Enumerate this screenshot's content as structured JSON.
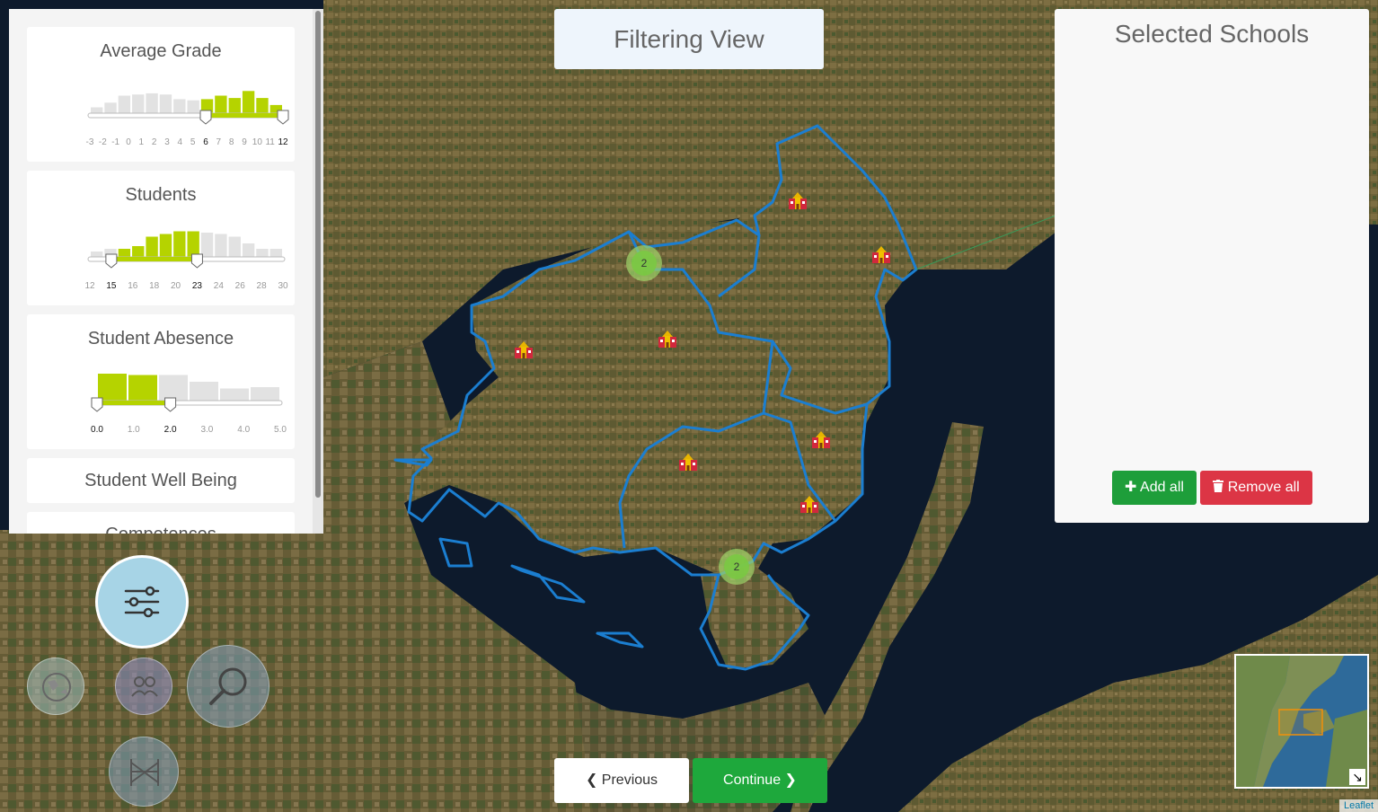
{
  "title": "Filtering View",
  "filters": {
    "average_grade": {
      "title": "Average Grade",
      "ticks": [
        "-3",
        "-2",
        "-1",
        "0",
        "1",
        "2",
        "3",
        "4",
        "5",
        "6",
        "7",
        "8",
        "9",
        "10",
        "11",
        "12"
      ],
      "selected_min": "6",
      "selected_max": "12",
      "histogram": [
        0.25,
        0.45,
        0.75,
        0.8,
        0.85,
        0.8,
        0.6,
        0.55,
        0.6,
        0.75,
        0.65,
        0.95,
        0.65,
        0.35
      ]
    },
    "students": {
      "title": "Students",
      "ticks": [
        "12",
        "15",
        "16",
        "18",
        "20",
        "23",
        "24",
        "26",
        "28",
        "30"
      ],
      "selected_min": "15",
      "selected_max": "23",
      "histogram": [
        0.2,
        0.3,
        0.3,
        0.4,
        0.75,
        0.85,
        0.95,
        0.95,
        0.9,
        0.85,
        0.75,
        0.5,
        0.3,
        0.3
      ]
    },
    "student_absence": {
      "title": "Student Abesence",
      "ticks": [
        "0.0",
        "1.0",
        "2.0",
        "3.0",
        "4.0",
        "5.0"
      ],
      "selected_min": "0.0",
      "selected_max": "2.0",
      "histogram": [
        1.0,
        0.95,
        0.95,
        0.7,
        0.45,
        0.5
      ]
    },
    "student_well_being": {
      "title": "Student Well Being"
    },
    "competences": {
      "title": "Competences"
    }
  },
  "selected_panel": {
    "title": "Selected Schools",
    "add_all_label": "Add all",
    "remove_all_label": "Remove all"
  },
  "nav": {
    "previous_label": "Previous",
    "continue_label": "Continue"
  },
  "map": {
    "clusters": [
      {
        "count": "2"
      },
      {
        "count": "2"
      }
    ],
    "school_marker_icon": "school-icon",
    "attribution": "Leaflet"
  },
  "tools": [
    "sliders-icon",
    "globe-icon",
    "people-icon",
    "search-icon",
    "parallel-coordinates-icon"
  ],
  "colors": {
    "histogram_selected": "#b5d300",
    "histogram_unselected": "#e2e2e2",
    "boundary": "#1b7ed0",
    "add_button": "#1e9e3a",
    "remove_button": "#dc3545",
    "continue_button": "#1ea83c",
    "active_tool": "#a7d4e6"
  }
}
